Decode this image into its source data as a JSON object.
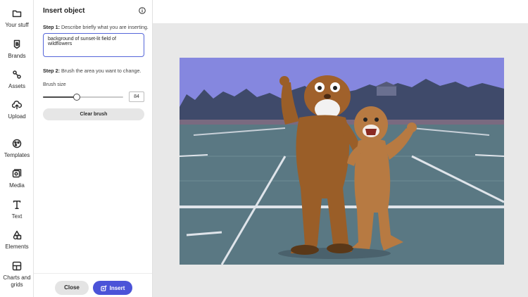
{
  "rail": [
    {
      "label": "Your stuff",
      "icon": "folder-icon"
    },
    {
      "label": "Brands",
      "icon": "brand-icon"
    },
    {
      "label": "Assets",
      "icon": "assets-icon"
    },
    {
      "label": "Upload",
      "icon": "upload-icon"
    },
    {
      "label": "Templates",
      "icon": "templates-icon"
    },
    {
      "label": "Media",
      "icon": "media-icon"
    },
    {
      "label": "Text",
      "icon": "text-icon"
    },
    {
      "label": "Elements",
      "icon": "elements-icon"
    },
    {
      "label": "Charts and grids",
      "icon": "charts-grids-icon"
    }
  ],
  "panel": {
    "title": "Insert object",
    "step1_label": "Step 1:",
    "step1_text": "Describe briefly what you are inserting.",
    "prompt_value": "background of sunset-lit field of wildflowers",
    "step2_label": "Step 2:",
    "step2_text": "Brush the area you want to change.",
    "brush_size_label": "Brush size",
    "brush_size_value": "84",
    "brush_size_fraction": 0.42,
    "clear_label": "Clear brush",
    "close_label": "Close",
    "insert_label": "Insert"
  },
  "colors": {
    "accent": "#4b53d8",
    "brush_overlay": "#7c7fd8"
  }
}
